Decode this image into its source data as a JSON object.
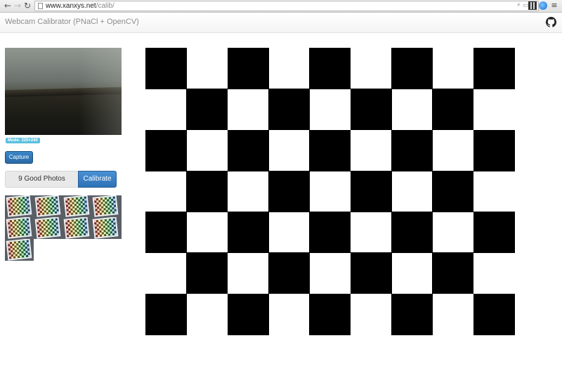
{
  "browser": {
    "url_host": "www.xanxys.net",
    "url_path": "/calib/",
    "back_glyph": "←",
    "forward_glyph": "→",
    "reload_glyph": "↻",
    "omni_icons": [
      "⚡",
      "▭",
      "☆"
    ],
    "menu_glyph": "≡"
  },
  "app": {
    "title": "Webcam Calibrator (PNaCl + OpenCV)",
    "github_icon": "github-icon"
  },
  "webcam": {
    "mode_label": "Mode: 320×240"
  },
  "controls": {
    "capture_label": "Capture",
    "good_photos_label": "9 Good Photos",
    "calibrate_label": "Calibrate"
  },
  "photos": {
    "count": 9
  },
  "checkerboard": {
    "rows": 7,
    "cols": 9,
    "colors": {
      "dark": "#000000",
      "light": "#ffffff"
    }
  },
  "colors": {
    "primary": "#2d71b6",
    "badge": "#5bc0de",
    "title_text": "#8c8c8c"
  }
}
